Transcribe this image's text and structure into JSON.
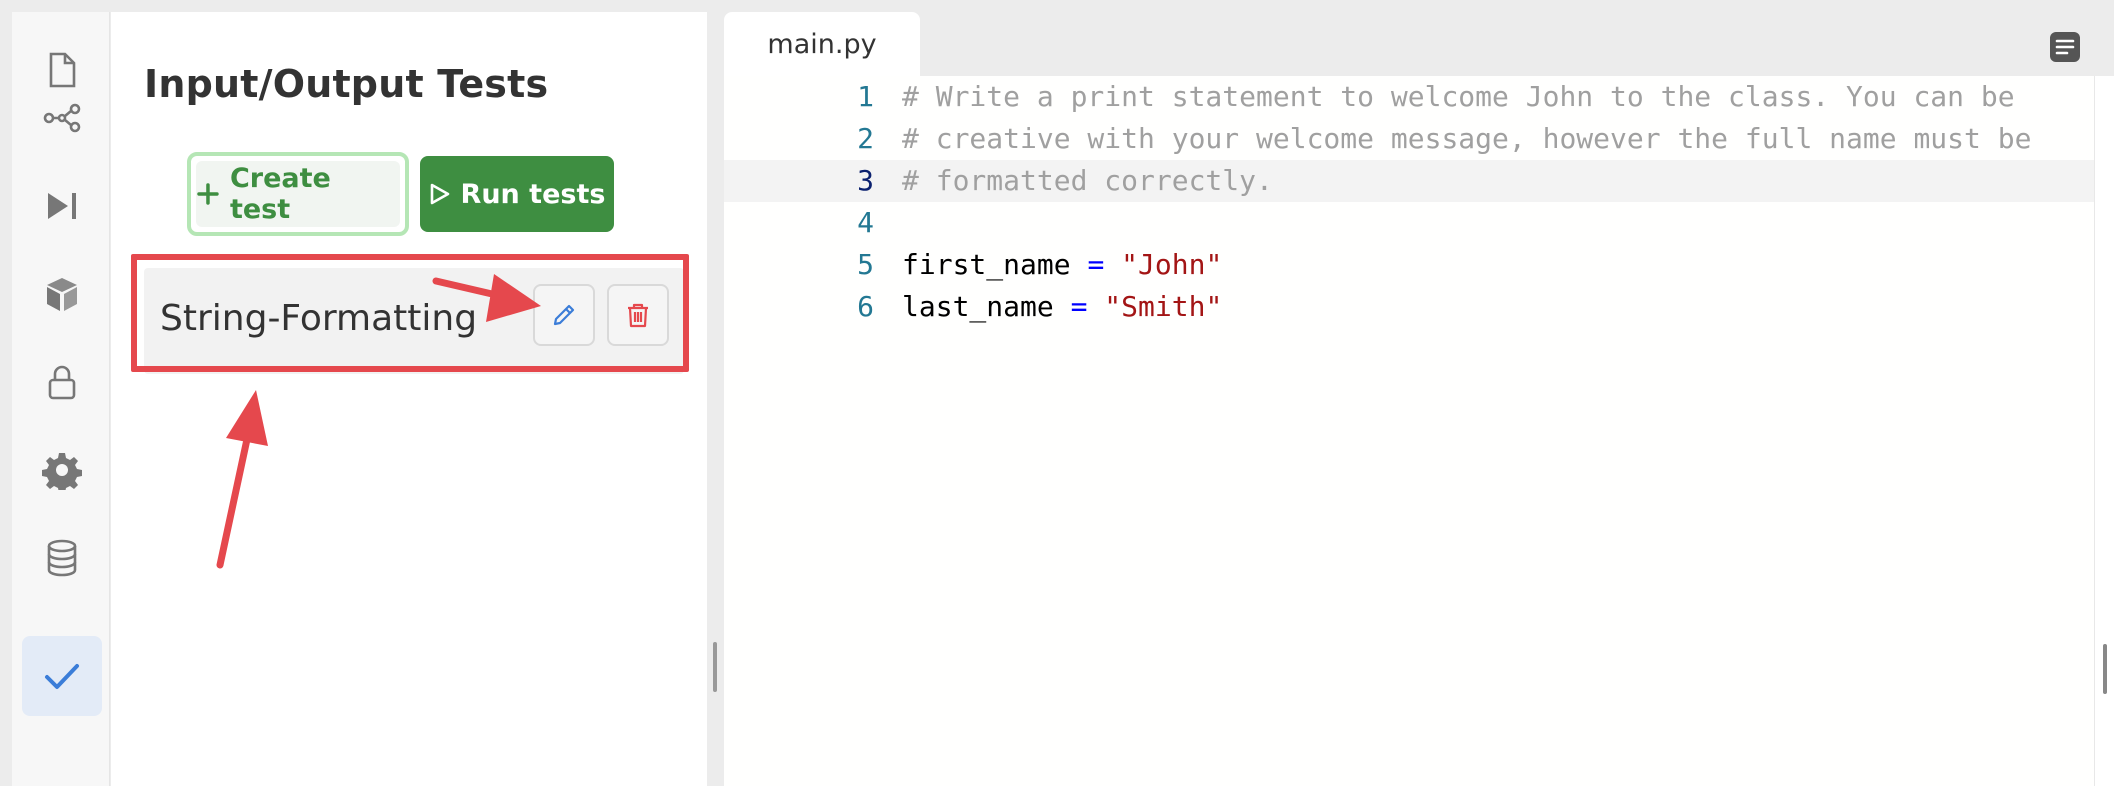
{
  "sidebar": {
    "items": [
      {
        "icon": "file-icon",
        "active": false
      },
      {
        "icon": "share-icon",
        "active": false
      },
      {
        "icon": "step-forward-icon",
        "active": false
      },
      {
        "icon": "package-icon",
        "active": false
      },
      {
        "icon": "lock-icon",
        "active": false
      },
      {
        "icon": "gear-icon",
        "active": false
      },
      {
        "icon": "database-icon",
        "active": false
      },
      {
        "icon": "checkmark-icon",
        "active": true
      }
    ]
  },
  "tests_panel": {
    "title": "Input/Output Tests",
    "create_label": "Create test",
    "run_label": "Run tests",
    "tests": [
      {
        "name": "String-Formatting"
      }
    ]
  },
  "editor": {
    "tab_label": "main.py",
    "current_line": 3,
    "lines": [
      {
        "num": "1",
        "tokens": [
          {
            "t": "# Write a print statement to welcome John to the class. You can be",
            "k": "comment"
          }
        ]
      },
      {
        "num": "2",
        "tokens": [
          {
            "t": "# creative with your welcome message, however the full name must be",
            "k": "comment"
          }
        ]
      },
      {
        "num": "3",
        "tokens": [
          {
            "t": "# formatted correctly.",
            "k": "comment"
          }
        ]
      },
      {
        "num": "4",
        "tokens": []
      },
      {
        "num": "5",
        "tokens": [
          {
            "t": "first_name ",
            "k": "plain"
          },
          {
            "t": "=",
            "k": "op"
          },
          {
            "t": " ",
            "k": "plain"
          },
          {
            "t": "\"John\"",
            "k": "str"
          }
        ]
      },
      {
        "num": "6",
        "tokens": [
          {
            "t": "last_name ",
            "k": "plain"
          },
          {
            "t": "=",
            "k": "op"
          },
          {
            "t": " ",
            "k": "plain"
          },
          {
            "t": "\"Smith\"",
            "k": "str"
          }
        ]
      }
    ]
  },
  "colors": {
    "accent_green": "#3e8e41",
    "annotation_red": "#e5484d",
    "active_blue": "#3b7dd8"
  }
}
